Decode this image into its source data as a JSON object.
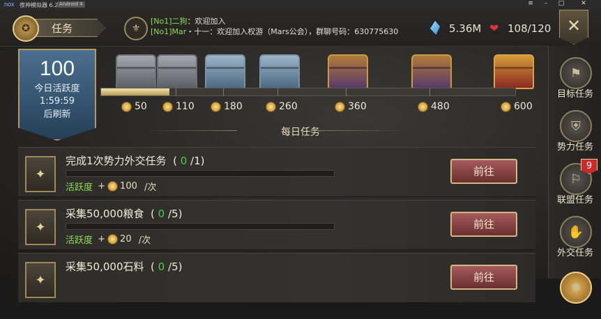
{
  "emulator": {
    "logo": "nox",
    "title": "夜神模拟器 6.2.6.1",
    "os_badge": "Android 4",
    "controls": [
      "≡",
      "–",
      "□",
      "✕"
    ]
  },
  "header": {
    "tab_title": "任务",
    "chat": [
      {
        "name": "[No1]二狗",
        "message": "：欢迎加入"
      },
      {
        "name": "[No1]Mar",
        "message": "・十一：欢迎加入权游（Mars公会），群聊号码：630775630"
      }
    ],
    "crystals": "5.36M",
    "health": "108/120"
  },
  "activity": {
    "points": "100",
    "label": "今日活跃度",
    "countdown": "1:59:59",
    "refresh_label": "后刷新"
  },
  "milestones": {
    "progress_fraction": 0.165,
    "values": [
      "50",
      "110",
      "180",
      "260",
      "360",
      "480",
      "600"
    ]
  },
  "daily": {
    "title": "每日任务"
  },
  "tasks": [
    {
      "name": "完成1次势力外交任务",
      "progress": "0",
      "total": "/1)",
      "reward_label": "活跃度",
      "reward_value": "100",
      "reward_unit": "/次",
      "button": "前往"
    },
    {
      "name": "采集50,000粮食",
      "progress": "0",
      "total": "/5)",
      "reward_label": "活跃度",
      "reward_value": "20",
      "reward_unit": "/次",
      "button": "前往"
    },
    {
      "name": "采集50,000石料",
      "progress": "0",
      "total": "/5)",
      "reward_label": "活跃度",
      "reward_value": "20",
      "reward_unit": "/次",
      "button": "前往"
    }
  ],
  "sidebar": [
    {
      "label": "目标任务",
      "badge": ""
    },
    {
      "label": "势力任务",
      "badge": ""
    },
    {
      "label": "联盟任务",
      "badge": "9"
    },
    {
      "label": "外交任务",
      "badge": ""
    }
  ]
}
